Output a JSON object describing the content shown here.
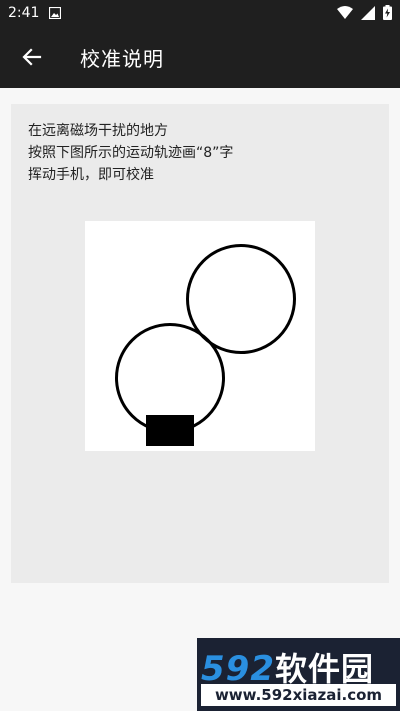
{
  "status_bar": {
    "time": "2:41"
  },
  "app_bar": {
    "title": "校准说明"
  },
  "instructions": {
    "line1": "在远离磁场干扰的地方",
    "line2": "按照下图所示的运动轨迹画“8”字",
    "line3": "挥动手机，即可校准"
  },
  "watermark": {
    "logo_num": "592",
    "logo_text": "软件园",
    "url": "www.592xiazai.com"
  },
  "colors": {
    "bar": "#1f1f1f",
    "card": "#ebebeb",
    "logo_blue": "#2a8fe0"
  }
}
